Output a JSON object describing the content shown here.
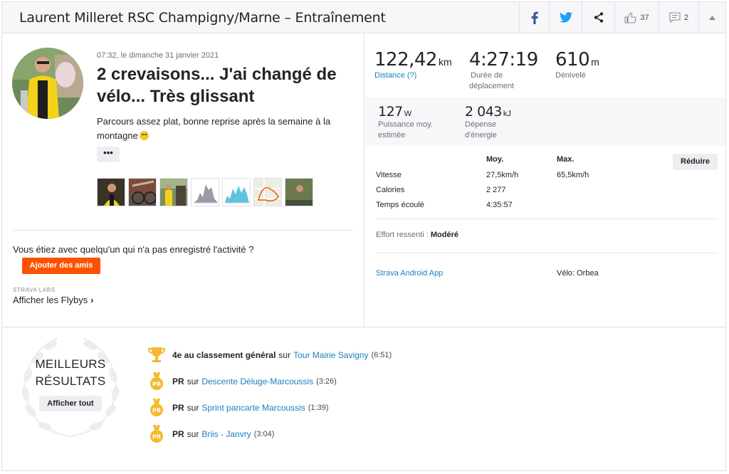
{
  "header": {
    "title": "Laurent Milleret RSC Champigny/Marne – Entraînement",
    "kudos_count": "37",
    "comments_count": "2"
  },
  "activity": {
    "timestamp": "07:32, le dimanche 31 janvier 2021",
    "title": "2 crevaisons... J'ai changé de vélo... Très glissant",
    "description": "Parcours assez plat, bonne reprise après la semaine à la montagne",
    "more_label": "•••"
  },
  "friends": {
    "question": "Vous étiez avec quelqu'un qui n'a pas enregistré l'activité ?",
    "add_button": "Ajouter des amis",
    "labs_label": "STRAVA LABS",
    "flybys_label": "Afficher les Flybys",
    "flybys_chevron": "›"
  },
  "stats": {
    "distance": {
      "value": "122,42",
      "unit": "km",
      "label": "Distance (?)"
    },
    "moving_time": {
      "value": "4:27:19",
      "label_line1": "Durée de",
      "label_line2": "déplacement"
    },
    "elevation": {
      "value": "610",
      "unit": "m",
      "label": "Dénivelé"
    },
    "power": {
      "value": "127",
      "unit": "W",
      "label_line1": "Puissance moy.",
      "label_line2": "estimée"
    },
    "energy": {
      "value": "2 043",
      "unit": "kJ",
      "label_line1": "Dépense",
      "label_line2": "d'énergie"
    }
  },
  "table": {
    "col_avg": "Moy.",
    "col_max": "Max.",
    "reduce_label": "Réduire",
    "rows": [
      {
        "label": "Vitesse",
        "avg": "27,5km/h",
        "max": "65,5km/h"
      },
      {
        "label": "Calories",
        "avg": "2 277",
        "max": ""
      },
      {
        "label": "Temps écoulé",
        "avg": "4:35:57",
        "max": ""
      }
    ]
  },
  "effort": {
    "label": "Effort ressenti :",
    "value": "Modéré"
  },
  "device": {
    "app": "Strava Android App",
    "bike": "Vélo: Orbea"
  },
  "best": {
    "title_line1": "MEILLEURS",
    "title_line2": "RÉSULTATS",
    "see_all": "Afficher tout",
    "items": [
      {
        "rank": "4e au classement général",
        "sur": "sur",
        "segment": "Tour Mairie Savigny",
        "time": "(6:51)",
        "icon": "trophy-icon"
      },
      {
        "rank": "PR",
        "sur": "sur",
        "segment": "Descente Déluge-Marcoussis",
        "time": "(3:26)",
        "icon": "pr-medal-icon"
      },
      {
        "rank": "PR",
        "sur": "sur",
        "segment": "Sprint pancarte Marcoussis",
        "time": "(1:39)",
        "icon": "pr-medal-icon"
      },
      {
        "rank": "PR",
        "sur": "sur",
        "segment": "Briis - Janvry",
        "time": "(3:04)",
        "icon": "pr-medal-icon"
      }
    ]
  },
  "colors": {
    "accent": "#fc5200",
    "link": "#1b7fbf",
    "medal": "#f5b82e"
  }
}
